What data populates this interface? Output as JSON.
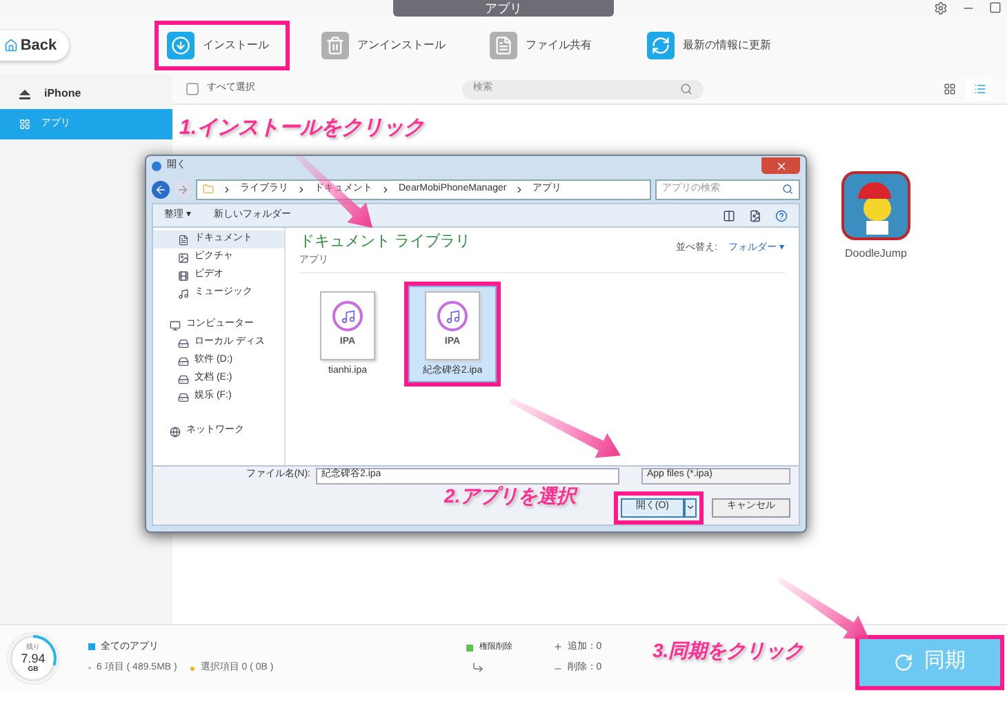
{
  "window": {
    "title": "アプリ"
  },
  "back_button": "Back",
  "toolbar": [
    {
      "kind": "install",
      "label": "インストール",
      "highlighted": true
    },
    {
      "kind": "uninstall",
      "label": "アンインストール",
      "highlighted": false
    },
    {
      "kind": "share",
      "label": "ファイル共有",
      "highlighted": false
    },
    {
      "kind": "refresh",
      "label": "最新の情報に更新",
      "highlighted": false
    }
  ],
  "sidebar": {
    "device": "iPhone",
    "items": [
      {
        "label": "アプリ",
        "selected": true
      }
    ]
  },
  "content_bar": {
    "select_all": {
      "label": "すべて選択",
      "checked": false
    },
    "search": {
      "placeholder": "検索"
    },
    "views": [
      {
        "kind": "grid",
        "selected": false
      },
      {
        "kind": "list",
        "selected": true
      }
    ]
  },
  "apps": [
    {
      "name": "DoodleJump"
    }
  ],
  "dialog": {
    "title": "開く",
    "path": [
      "ライブラリ",
      "ドキュメント",
      "DearMobiPhoneManager",
      "アプリ"
    ],
    "search": {
      "placeholder": "アプリの検索"
    },
    "commands": [
      "整理 ▾",
      "新しいフォルダー"
    ],
    "nav": [
      {
        "kind": "documents",
        "label": "ドキュメント",
        "selected": true
      },
      {
        "kind": "pictures",
        "label": "ピクチャ",
        "selected": false
      },
      {
        "kind": "video",
        "label": "ビデオ",
        "selected": false
      },
      {
        "kind": "music",
        "label": "ミュージック",
        "selected": false
      },
      {
        "kind": "computer",
        "label": "コンピューター",
        "selected": false
      },
      {
        "kind": "disk",
        "label": "ローカル ディス",
        "selected": false
      },
      {
        "kind": "drive",
        "label": "软件 (D:)",
        "selected": false
      },
      {
        "kind": "drive",
        "label": "文档 (E:)",
        "selected": false
      },
      {
        "kind": "drive",
        "label": "娱乐 (F:)",
        "selected": false
      },
      {
        "kind": "network",
        "label": "ネットワーク",
        "selected": false
      }
    ],
    "library_title": "ドキュメント ライブラリ",
    "library_subtitle": "アプリ",
    "sort_label": "並べ替え:",
    "sort_value": "フォルダー ▾",
    "files": [
      {
        "name": "tianhi.ipa",
        "type": "IPA",
        "selected": false
      },
      {
        "name": "紀念碑谷2.ipa",
        "type": "IPA",
        "selected": true
      }
    ],
    "file_name_label": "ファイル名(N):",
    "file_name": "紀念碑谷2.ipa",
    "file_type": "App files (*.ipa)",
    "open_button": {
      "label": "開く(O)",
      "highlighted": true
    },
    "cancel_button": "キャンセル"
  },
  "status_bar": {
    "storage_label": "残り",
    "storage_value": "7.94",
    "storage_unit": "GB",
    "level": 0.3,
    "all_apps": "全てのアプリ",
    "count": "6 項目 ( 489.5MB )",
    "selected": "選択項目 0 ( 0B )",
    "remove_permission": "権限削除",
    "added": "追加：0",
    "removed": "削除：0",
    "sync_button": {
      "label": "同期",
      "highlighted": true
    }
  },
  "annotations": [
    "1.インストールをクリック",
    "2.アプリを選択",
    "3.同期をクリック"
  ]
}
